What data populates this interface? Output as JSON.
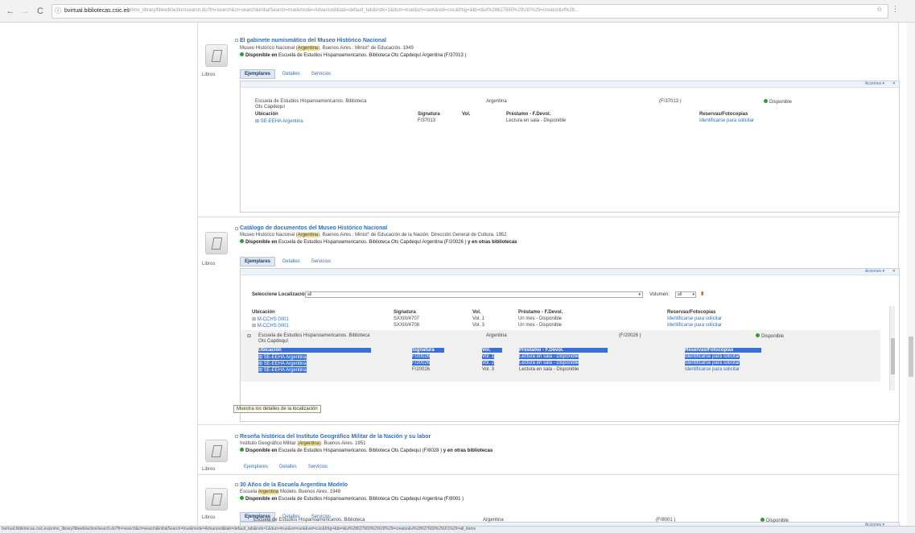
{
  "browser": {
    "host": "bvirtual.bibliotecas.csic.es",
    "path": "/primo_library/libweb/action/search.do?fn=search&ct=search&initialSearch=true&mode=Advanced&tab=default_tab&indx=1&dum=true&srt=rank&vid=csic&frbg=&tb=t&vl%28627660%29UI0%29=creator&vl%28...",
    "status_url": "bvirtual.bibliotecas.csic.es/primo_library/libweb/action/search.do?fn=search&ct=search&initialSearch=true&mode=Advanced&tab=default_tab&indx=1&dum=true&srt=rank&vid=csic&frbg=&tb=t&vl%28627660%29UI0%29=creator&vl%28627660%29UI1%29=all_items"
  },
  "records": [
    {
      "title": "El gabinete numismático del Museo Histórico Nacional",
      "meta_before": "Museo Histórico Nacional (",
      "meta_hl": "Argentina",
      "meta_after": "). Buenos Aires : Minist° de Educación. 1949",
      "avail_bold": "Disponible en",
      "avail_text": " Escuela de Estudios Hispanoamericanos. Biblioteca Ots Capdequí Argentina (F/37013 )",
      "format": "Libros",
      "tabs": [
        "Ejemplares",
        "Detalles",
        "Servicios"
      ],
      "panel": {
        "acciones": "Acciones ▾",
        "lib_name": "Escuela de Estudios Hispanoamericanos. Biblioteca",
        "lib_name2": "Ots Capdequí",
        "lib_coll": "Argentina",
        "lib_sig": "(F/37013 )",
        "lib_status": "Disponible",
        "headers": [
          "Ubicación",
          "Signatura",
          "Vol.",
          "Préstamo - F.Devol.",
          "Reservas/Fotocopias"
        ],
        "rows": [
          [
            "SE-EEHA Argentina",
            "F/37013",
            "",
            "Lectura en sala - Disponible",
            "Identificarse para solicitar"
          ]
        ]
      }
    },
    {
      "title": "Catálogo de documentos del Museo Histórico Nacional",
      "meta_before": "Museo Histórico Nacional (",
      "meta_hl": "Argentina",
      "meta_after": "). Buenos Aires : Minist° de Educación de la Nación. Dirección General de Cultura. 1952",
      "avail_bold": "Disponible en",
      "avail_text": " Escuela de Estudios Hispanoamericanos. Biblioteca Ots Capdequí Argentina (F/20026 ) ",
      "avail_more": "y en otras bibliotecas",
      "format": "Libros",
      "tabs": [
        "Ejemplares",
        "Detalles",
        "Servicios"
      ],
      "panel": {
        "acciones": "Acciones ▾",
        "select_label": "Seleccione Localización:",
        "select_value": "all",
        "volumes_label": "Volumen:",
        "volumes_value": "all",
        "headers": [
          "Ubicación",
          "Signatura",
          "Vol.",
          "Préstamo - F.Devol.",
          "Reservas/Fotocopias"
        ],
        "rows": [
          [
            "M-CCHS 0001",
            "SXXIII/4707",
            "Vol. 1",
            "Un mes - Disponible",
            "Identificarse para solicitar"
          ],
          [
            "M-CCHS 0001",
            "SXXIII/4708",
            "Vol. 3",
            "Un mes - Disponible",
            "Identificarse para solicitar"
          ]
        ],
        "lib_name": "Escuela de Estudios Hispanoamericanos. Biblioteca",
        "lib_name2": "Ots Capdequí",
        "lib_coll": "Argentina",
        "lib_sig": "(F/20026 )",
        "lib_status": "Disponible",
        "sub_headers": [
          "Ubicación",
          "Signatura",
          "Vol.",
          "Préstamo - F.Devol.",
          "Reservas/Fotocopias"
        ],
        "sub_rows": [
          [
            "SE-EEHA Argentina",
            "F/20026",
            "Vol. 1",
            "Lectura en sala - Disponible",
            "Identificarse para solicitar"
          ],
          [
            "SE-EEHA Argentina",
            "F/20026",
            "Vol. 2",
            "Lectura en sala - Disponible",
            "Identificarse para solicitar"
          ],
          [
            "SE-EEHA Argentina",
            "F/20026",
            "Vol. 3",
            "Lectura en sala - Disponible",
            "Identificarse para solicitar"
          ]
        ]
      }
    },
    {
      "title": "Reseña histórica del Instituto Geográfico Militar de la Nación y su labor",
      "meta_before": "Instituto Geográfico Militar (",
      "meta_hl": "Argentina",
      "meta_after": "). Buenos Aires. 1951",
      "avail_bold": "Disponible en",
      "avail_text": " Escuela de Estudios Hispanoamericanos. Biblioteca Ots Capdequí (F/8028 ) ",
      "avail_more": "y en otras bibliotecas",
      "format": "Libros",
      "tabs": [
        "Ejemplares",
        "Detalles",
        "Servicios"
      ]
    },
    {
      "title": "30 Años de la Escuela Argentina Modelo",
      "meta_before": "Escuela ",
      "meta_hl": "Argentina",
      "meta_after": " Modelo. Buenos Aires. 1948",
      "avail_bold": "Disponible en",
      "avail_text": " Escuela de Estudios Hispanoamericanos. Biblioteca Ots Capdequí Argentina (F/8001 )",
      "format": "Libros",
      "tabs": [
        "Ejemplares",
        "Detalles",
        "Servicios"
      ],
      "panel": {
        "acciones": "Acciones ▾",
        "lib_name": "Escuela de Estudios Hispanoamericanos. Biblioteca",
        "lib_coll": "Argentina",
        "lib_sig": "(F/8001 )",
        "lib_status": "Disponible"
      }
    }
  ],
  "tooltip": "Muestra los detalles de la localización"
}
